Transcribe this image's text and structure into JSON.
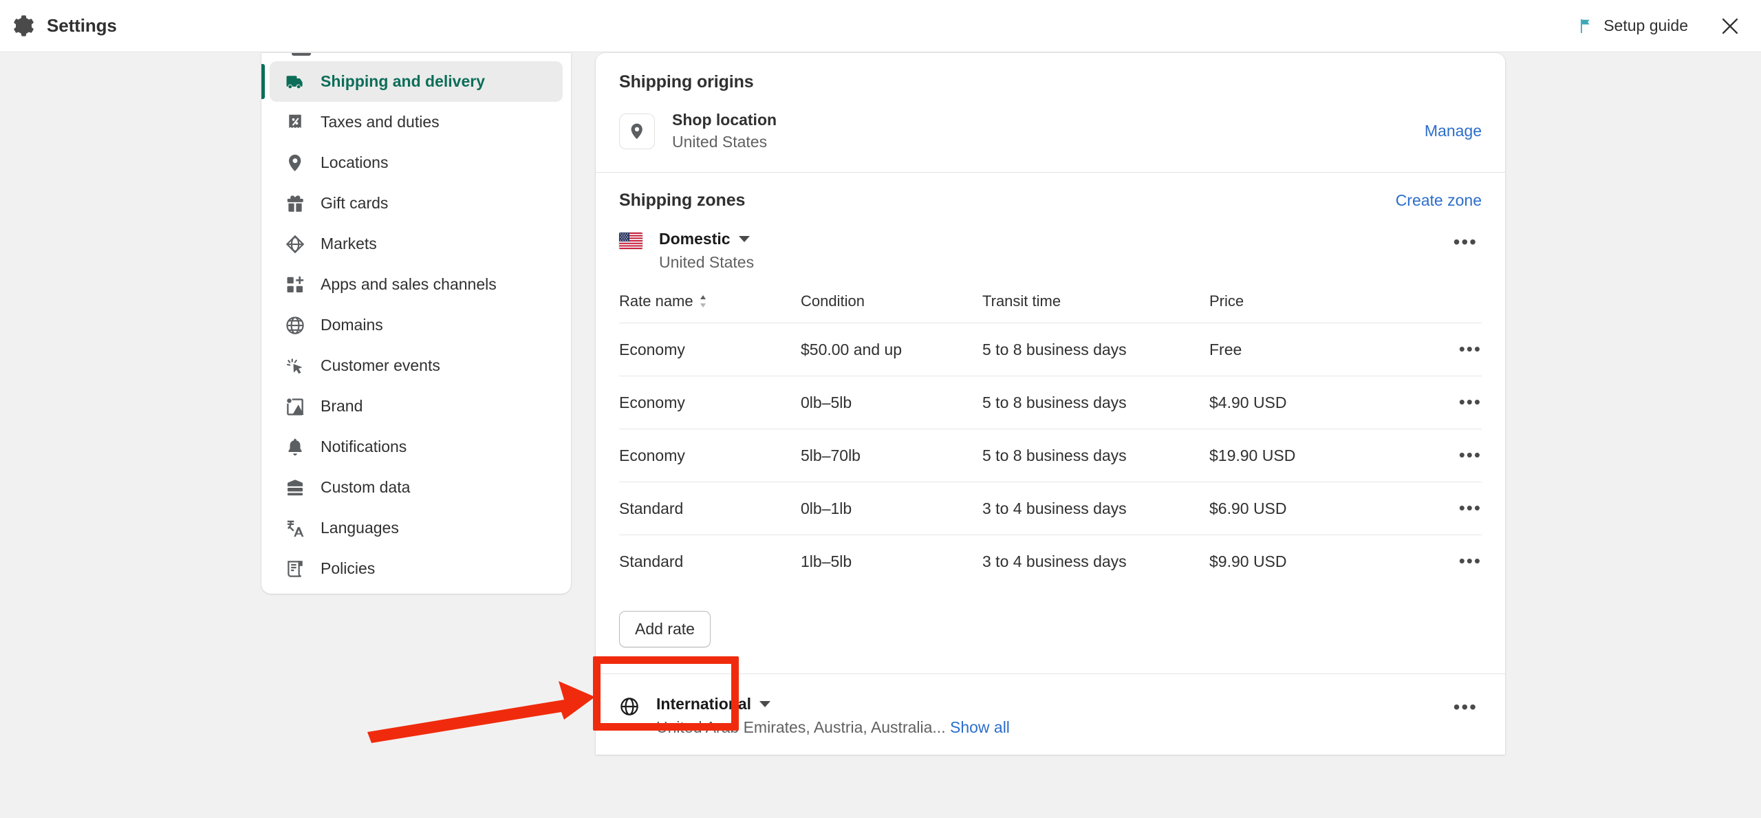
{
  "header": {
    "title": "Settings",
    "gear_icon": "gear-icon",
    "setup_guide_label": "Setup guide",
    "flag_icon": "flag-icon",
    "close_icon": "close-icon"
  },
  "sidebar": {
    "items": [
      {
        "label": "Shipping and delivery",
        "icon": "truck-icon",
        "active": true
      },
      {
        "label": "Taxes and duties",
        "icon": "receipt-percent-icon",
        "active": false
      },
      {
        "label": "Locations",
        "icon": "location-pin-icon",
        "active": false
      },
      {
        "label": "Gift cards",
        "icon": "gift-icon",
        "active": false
      },
      {
        "label": "Markets",
        "icon": "globe-target-icon",
        "active": false
      },
      {
        "label": "Apps and sales channels",
        "icon": "apps-plus-icon",
        "active": false
      },
      {
        "label": "Domains",
        "icon": "globe-icon",
        "active": false
      },
      {
        "label": "Customer events",
        "icon": "cursor-click-icon",
        "active": false
      },
      {
        "label": "Brand",
        "icon": "image-icon",
        "active": false
      },
      {
        "label": "Notifications",
        "icon": "bell-icon",
        "active": false
      },
      {
        "label": "Custom data",
        "icon": "database-icon",
        "active": false
      },
      {
        "label": "Languages",
        "icon": "translate-icon",
        "active": false
      },
      {
        "label": "Policies",
        "icon": "scroll-icon",
        "active": false
      }
    ]
  },
  "main": {
    "origins": {
      "title": "Shipping origins",
      "location_icon": "location-pin-icon",
      "location_name": "Shop location",
      "location_country": "United States",
      "manage_label": "Manage"
    },
    "zones": {
      "title": "Shipping zones",
      "create_zone_label": "Create zone",
      "domestic": {
        "flag_icon": "us-flag-icon",
        "name": "Domestic",
        "countries": "United States",
        "kebab_icon": "more-options-icon",
        "caret_icon": "chevron-down-icon",
        "table": {
          "columns": [
            "Rate name",
            "Condition",
            "Transit time",
            "Price"
          ],
          "sort_icon": "sort-arrows-icon",
          "rows": [
            {
              "rate_name": "Economy",
              "condition": "$50.00 and up",
              "transit_time": "5 to 8 business days",
              "price": "Free"
            },
            {
              "rate_name": "Economy",
              "condition": "0lb–5lb",
              "transit_time": "5 to 8 business days",
              "price": "$4.90 USD"
            },
            {
              "rate_name": "Economy",
              "condition": "5lb–70lb",
              "transit_time": "5 to 8 business days",
              "price": "$19.90 USD"
            },
            {
              "rate_name": "Standard",
              "condition": "0lb–1lb",
              "transit_time": "3 to 4 business days",
              "price": "$6.90 USD"
            },
            {
              "rate_name": "Standard",
              "condition": "1lb–5lb",
              "transit_time": "3 to 4 business days",
              "price": "$9.90 USD"
            }
          ]
        },
        "add_rate_label": "Add rate"
      },
      "international": {
        "globe_icon": "globe-icon",
        "name": "International",
        "countries": "United Arab Emirates, Austria, Australia...",
        "show_all_label": "Show all",
        "kebab_icon": "more-options-icon",
        "caret_icon": "chevron-down-icon"
      }
    }
  },
  "annotation": {
    "highlight_color": "#f02b0d",
    "target": "Add rate"
  }
}
